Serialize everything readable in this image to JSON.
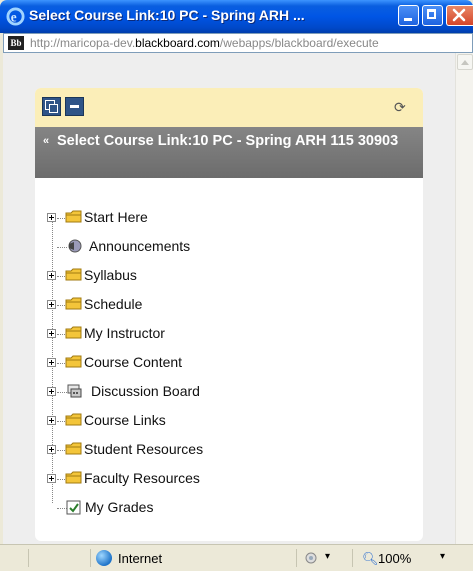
{
  "window": {
    "title": "Select Course Link:10 PC - Spring ARH ...",
    "icon": "ie-icon"
  },
  "address": {
    "url_prefix": "http://maricopa-dev.",
    "url_domain": "blackboard.com",
    "url_suffix": "/webapps/blackboard/execute",
    "favicon_text": "Bb"
  },
  "panel": {
    "refresh_glyph": "⟳",
    "header_chevron": "«",
    "header_title": "Select Course Link:10 PC - Spring ARH 115 30903",
    "items": [
      {
        "label": "Start Here",
        "icon": "folder-icon",
        "expandable": true
      },
      {
        "label": "Announcements",
        "icon": "announcement-icon",
        "expandable": false
      },
      {
        "label": "Syllabus",
        "icon": "folder-icon",
        "expandable": true
      },
      {
        "label": "Schedule",
        "icon": "folder-icon",
        "expandable": true
      },
      {
        "label": "My Instructor",
        "icon": "folder-icon",
        "expandable": true
      },
      {
        "label": "Course Content",
        "icon": "folder-icon",
        "expandable": true
      },
      {
        "label": "Discussion Board",
        "icon": "discussion-icon",
        "expandable": true
      },
      {
        "label": "Course Links",
        "icon": "folder-icon",
        "expandable": true
      },
      {
        "label": "Student Resources",
        "icon": "folder-icon",
        "expandable": true
      },
      {
        "label": "Faculty Resources",
        "icon": "folder-icon",
        "expandable": true
      },
      {
        "label": "My Grades",
        "icon": "grades-icon",
        "expandable": false
      }
    ]
  },
  "status": {
    "zone": "Internet",
    "zoom": "100%",
    "dropdown_glyph": "▾"
  },
  "colors": {
    "titlebar": "#0055e5",
    "toolbar_bg": "#fbeeb8",
    "header_bg": "#777777",
    "folder": "#f3c53a"
  }
}
